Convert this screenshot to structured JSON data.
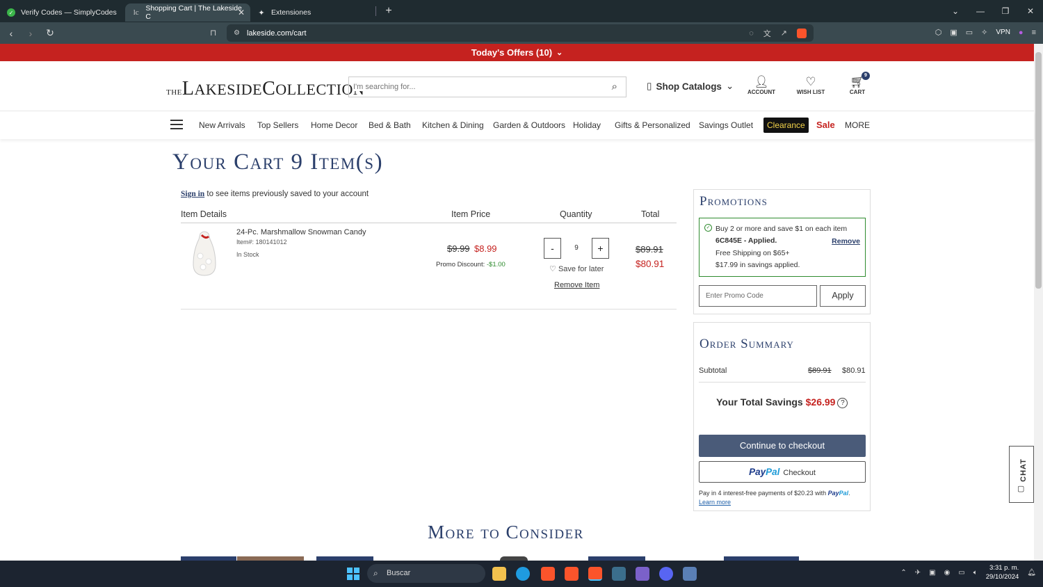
{
  "browser": {
    "tabs": [
      {
        "title": "Verify Codes — SimplyCodes",
        "active": false
      },
      {
        "title": "Shopping Cart | The Lakeside C",
        "active": true
      },
      {
        "title": "Extensiones",
        "active": false
      }
    ],
    "url": "lakeside.com/cart",
    "vpn_label": "VPN",
    "shield_count": "6"
  },
  "offer_bar": {
    "label": "Today's Offers (10)"
  },
  "header": {
    "logo_the": "THE",
    "logo_l": "L",
    "logo_akeside": "AKESIDE",
    "logo_c": "C",
    "logo_ollection": "OLLECTION",
    "search_placeholder": "I'm searching for...",
    "shop_catalogs": "Shop Catalogs",
    "account_label": "ACCOUNT",
    "wishlist_label": "WISH LIST",
    "cart_label": "CART",
    "cart_count": "9"
  },
  "nav": {
    "items": [
      "New Arrivals",
      "Top Sellers",
      "Home Decor",
      "Bed & Bath",
      "Kitchen & Dining",
      "Garden & Outdoors",
      "Holiday",
      "Gifts & Personalized",
      "Savings Outlet"
    ],
    "clearance": "Clearance",
    "sale": "Sale",
    "more": "MORE"
  },
  "cart": {
    "title": "Your Cart 9 Item(s)",
    "signin_link": "Sign in",
    "signin_text": " to see items previously saved to your account",
    "columns": {
      "details": "Item Details",
      "price": "Item Price",
      "quantity": "Quantity",
      "total": "Total"
    },
    "item": {
      "name": "24-Pc. Marshmallow Snowman Candy",
      "item_number": "Item#: 180141012",
      "stock": "In Stock",
      "old_price": "$9.99",
      "price": "$8.99",
      "promo_label": "Promo Discount: ",
      "promo_value": "-$1.00",
      "quantity": "9",
      "minus": "-",
      "plus": "+",
      "save_for_later": "Save for later",
      "remove": "Remove Item",
      "total_old": "$89.91",
      "total_new": "$80.91"
    }
  },
  "promotions": {
    "title": "Promotions",
    "line1": "Buy 2 or more and save $1 on each item",
    "code": "6C845E - Applied.",
    "remove": "Remove",
    "line3": "Free Shipping on $65+",
    "line4": "$17.99 in savings applied.",
    "input_placeholder": "Enter Promo Code",
    "apply": "Apply"
  },
  "order_summary": {
    "title": "Order Summary",
    "subtotal_label": "Subtotal",
    "subtotal_old": "$89.91",
    "subtotal_new": "$80.91",
    "savings_label": "Your Total Savings ",
    "savings_amount": "$26.99",
    "help": "?",
    "checkout": "Continue to checkout",
    "paypal_pay": "Pay",
    "paypal_pal": "Pal",
    "paypal_checkout": "Checkout",
    "pay_in_4": "Pay in 4 interest-free payments of $20.23 with ",
    "learn_more": "Learn more"
  },
  "more_to_consider": "More to Consider",
  "chat_label": "CHAT",
  "taskbar": {
    "search": "Buscar",
    "time": "3:31 p. m.",
    "date": "29/10/2024"
  },
  "colors": {
    "offer_red": "#c5221f",
    "navy": "#2b3f6b",
    "promo_green": "#2e8b2e",
    "checkout_button": "#4a5b79"
  }
}
